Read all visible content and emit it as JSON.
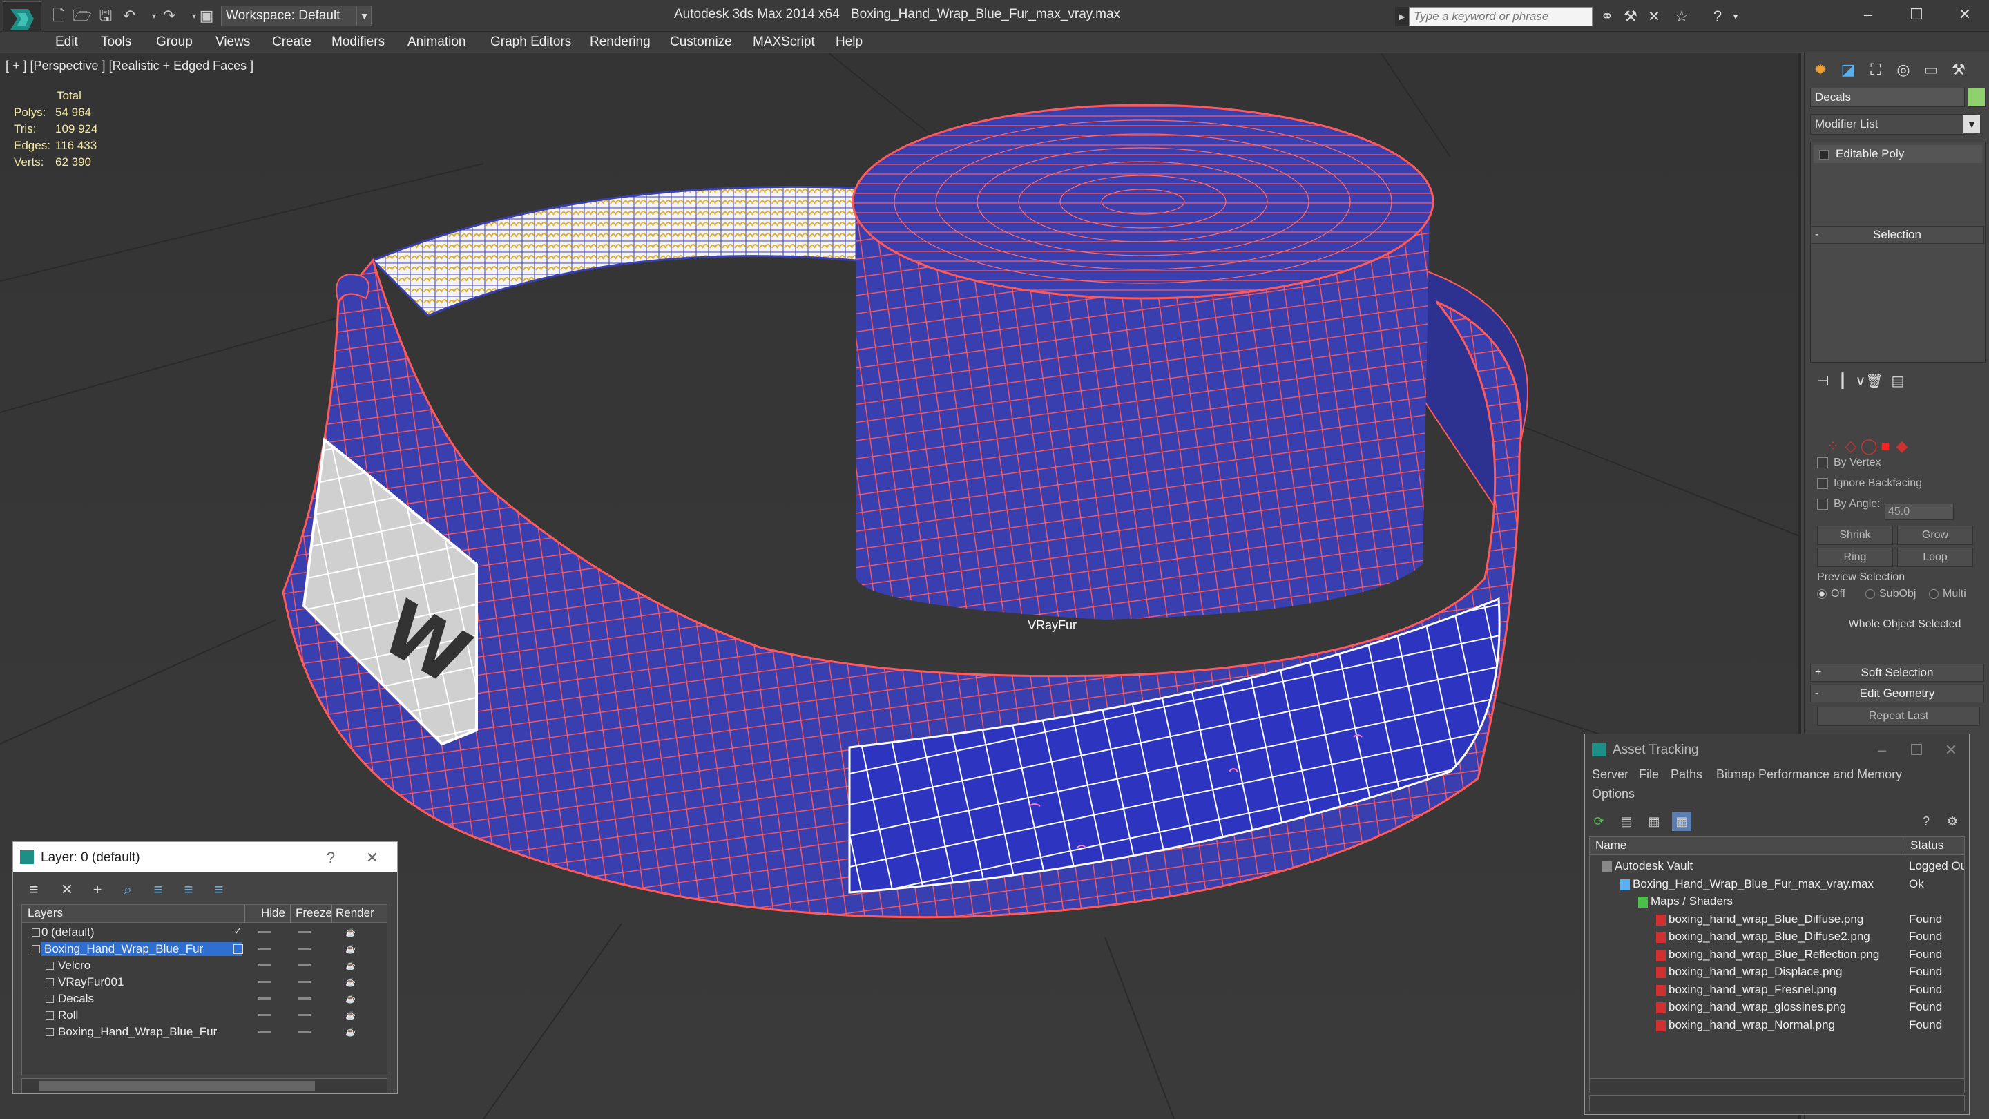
{
  "titlebar": {
    "workspace": "Workspace: Default",
    "app_title": "Autodesk 3ds Max  2014 x64",
    "file_title": "Boxing_Hand_Wrap_Blue_Fur_max_vray.max",
    "search_placeholder": "Type a keyword or phrase"
  },
  "menu": [
    "Edit",
    "Tools",
    "Group",
    "Views",
    "Create",
    "Modifiers",
    "Animation",
    "Graph Editors",
    "Rendering",
    "Customize",
    "MAXScript",
    "Help"
  ],
  "viewport": {
    "label": "[ + ] [Perspective ] [Realistic + Edged Faces ]",
    "stats": {
      "header": "Total",
      "rows": [
        {
          "label": "Polys:",
          "value": "54 964"
        },
        {
          "label": "Tris:",
          "value": "109 924"
        },
        {
          "label": "Edges:",
          "value": "116 433"
        },
        {
          "label": "Verts:",
          "value": "62 390"
        }
      ]
    },
    "object_label": "VRayFur",
    "colors": {
      "fabric": "#3a3fb0",
      "wire": "#ff5a5a",
      "velcro": "#f0c040"
    }
  },
  "command_panel": {
    "object_name": "Decals",
    "modifier_list": "Modifier List",
    "stack_item": "Editable Poly",
    "selection_title": "Selection",
    "by_vertex": "By Vertex",
    "ignore_backfacing": "Ignore Backfacing",
    "by_angle": "By Angle:",
    "angle_value": "45.0",
    "shrink": "Shrink",
    "grow": "Grow",
    "ring": "Ring",
    "loop": "Loop",
    "preview_selection": "Preview Selection",
    "preview_off": "Off",
    "preview_subobj": "SubObj",
    "preview_multi": "Multi",
    "whole_object": "Whole Object Selected",
    "soft_selection": "Soft Selection",
    "edit_geometry": "Edit Geometry",
    "repeat_last": "Repeat Last",
    "soft_sign": "+",
    "edit_sign": "-",
    "selection_sign": "-"
  },
  "asset_tracking": {
    "title": "Asset Tracking",
    "menus": [
      "Server",
      "File",
      "Paths",
      "Bitmap Performance and Memory",
      "Options"
    ],
    "columns": {
      "name": "Name",
      "status": "Status"
    },
    "rows": [
      {
        "name": "Autodesk Vault",
        "status": "Logged Out",
        "indent": 0
      },
      {
        "name": "Boxing_Hand_Wrap_Blue_Fur_max_vray.max",
        "status": "Ok",
        "indent": 1
      },
      {
        "name": "Maps / Shaders",
        "status": "",
        "indent": 2
      },
      {
        "name": "boxing_hand_wrap_Blue_Diffuse.png",
        "status": "Found",
        "indent": 3
      },
      {
        "name": "boxing_hand_wrap_Blue_Diffuse2.png",
        "status": "Found",
        "indent": 3
      },
      {
        "name": "boxing_hand_wrap_Blue_Reflection.png",
        "status": "Found",
        "indent": 3
      },
      {
        "name": "boxing_hand_wrap_Displace.png",
        "status": "Found",
        "indent": 3
      },
      {
        "name": "boxing_hand_wrap_Fresnel.png",
        "status": "Found",
        "indent": 3
      },
      {
        "name": "boxing_hand_wrap_glossines.png",
        "status": "Found",
        "indent": 3
      },
      {
        "name": "boxing_hand_wrap_Normal.png",
        "status": "Found",
        "indent": 3
      }
    ]
  },
  "layer_window": {
    "title": "Layer: 0 (default)",
    "columns": {
      "layers": "Layers",
      "hide": "Hide",
      "freeze": "Freeze",
      "render": "Render"
    },
    "rows": [
      {
        "name": "0 (default)",
        "indent": 0,
        "selected": false
      },
      {
        "name": "Boxing_Hand_Wrap_Blue_Fur",
        "indent": 0,
        "selected": true
      },
      {
        "name": "Velcro",
        "indent": 1,
        "selected": false
      },
      {
        "name": "VRayFur001",
        "indent": 1,
        "selected": false
      },
      {
        "name": "Decals",
        "indent": 1,
        "selected": false
      },
      {
        "name": "Roll",
        "indent": 1,
        "selected": false
      },
      {
        "name": "Boxing_Hand_Wrap_Blue_Fur",
        "indent": 1,
        "selected": false
      }
    ]
  }
}
